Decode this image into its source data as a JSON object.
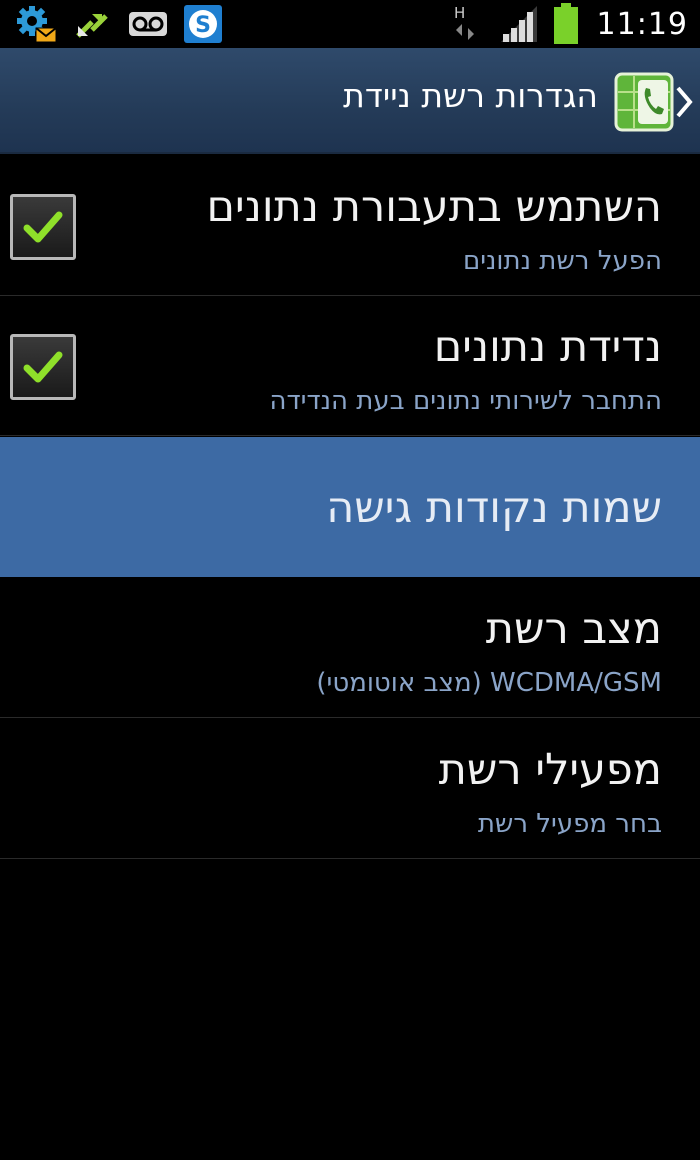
{
  "status_bar": {
    "time": "11:19",
    "network_type": "H",
    "icons_left": [
      "settings-mail-icon",
      "sync-icon",
      "voicemail-icon",
      "skype-icon"
    ],
    "icons_right": [
      "data-transfer-icon",
      "signal-icon",
      "battery-icon"
    ],
    "battery_color": "#7ad12a"
  },
  "action_bar": {
    "title": "הגדרות רשת ניידת",
    "accent": "#2f4a6b"
  },
  "settings": [
    {
      "title": "השתמש בתעבורת נתונים",
      "subtitle": "הפעל רשת נתונים",
      "checked": true
    },
    {
      "title": "נדידת נתונים",
      "subtitle": "התחבר לשירותי נתונים בעת הנדידה",
      "checked": true
    },
    {
      "title": "שמות נקודות גישה",
      "highlighted": true
    },
    {
      "title": "מצב רשת",
      "subtitle": "WCDMA/GSM (מצב אוטומטי)"
    },
    {
      "title": "מפעילי רשת",
      "subtitle": "בחר מפעיל רשת"
    }
  ],
  "colors": {
    "highlight": "#3d6aa4",
    "checkmark": "#8fe02a",
    "subtitle": "#8aa4c8"
  }
}
